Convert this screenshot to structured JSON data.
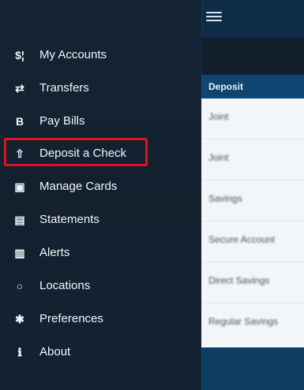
{
  "menu": {
    "items": [
      {
        "label": "My Accounts",
        "icon_glyph": "$¦"
      },
      {
        "label": "Transfers",
        "icon_glyph": "⇄"
      },
      {
        "label": "Pay Bills",
        "icon_glyph": "B"
      },
      {
        "label": "Deposit a Check",
        "icon_glyph": "⇧"
      },
      {
        "label": "Manage Cards",
        "icon_glyph": "▣"
      },
      {
        "label": "Statements",
        "icon_glyph": "▤"
      },
      {
        "label": "Alerts",
        "icon_glyph": "▥"
      },
      {
        "label": "Locations",
        "icon_glyph": "○"
      },
      {
        "label": "Preferences",
        "icon_glyph": "✱"
      },
      {
        "label": "About",
        "icon_glyph": "ℹ"
      }
    ]
  },
  "header": {
    "menu_icon": "hamburger-icon"
  },
  "deposit": {
    "header": "Deposit",
    "accounts": [
      {
        "label": "Joint"
      },
      {
        "label": "Joint"
      },
      {
        "label": "Savings"
      },
      {
        "label": "Secure Account"
      },
      {
        "label": "Direct Savings"
      },
      {
        "label": "Regular Savings"
      }
    ]
  },
  "colors": {
    "drawer_background": "#13202e",
    "deposit_header": "#0e4571",
    "highlight_border": "#d8161d",
    "right_panel_background": "#0d2136"
  }
}
